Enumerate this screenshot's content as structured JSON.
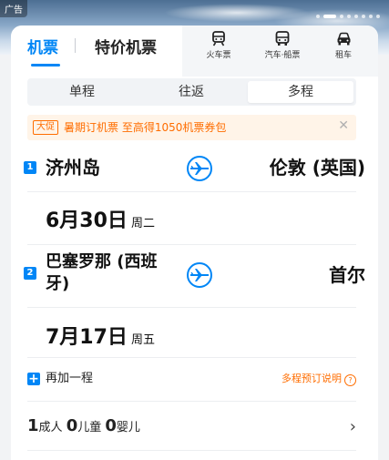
{
  "banner": {
    "ad_label": "广告"
  },
  "tabs": {
    "flights": "机票",
    "deals": "特价机票",
    "modes": [
      {
        "icon": "train-icon",
        "label": "火车票"
      },
      {
        "icon": "bus-icon",
        "label": "汽车·船票"
      },
      {
        "icon": "car-icon",
        "label": "租车"
      }
    ]
  },
  "trip_type": {
    "options": [
      "单程",
      "往返",
      "多程"
    ],
    "selected": "多程"
  },
  "promo": {
    "tag": "大促",
    "text": "暑期订机票 至高得1050机票券包"
  },
  "segments": [
    {
      "index": "1",
      "from": "济州岛",
      "to": "伦敦 (英国)",
      "date": "6月30日",
      "weekday": "周二"
    },
    {
      "index": "2",
      "from_line1": "巴塞罗那 (西班",
      "from_line2": "牙)",
      "to": "首尔",
      "date": "7月17日",
      "weekday": "周五"
    }
  ],
  "add_segment": {
    "label": "再加一程",
    "rules": "多程预订说明"
  },
  "passengers": {
    "adult_count": "1",
    "adult_label": "成人",
    "child_count": "0",
    "child_label": "儿童",
    "infant_count": "0",
    "infant_label": "婴儿"
  },
  "colors": {
    "accent": "#0086f6",
    "promo": "#ff6d00"
  }
}
